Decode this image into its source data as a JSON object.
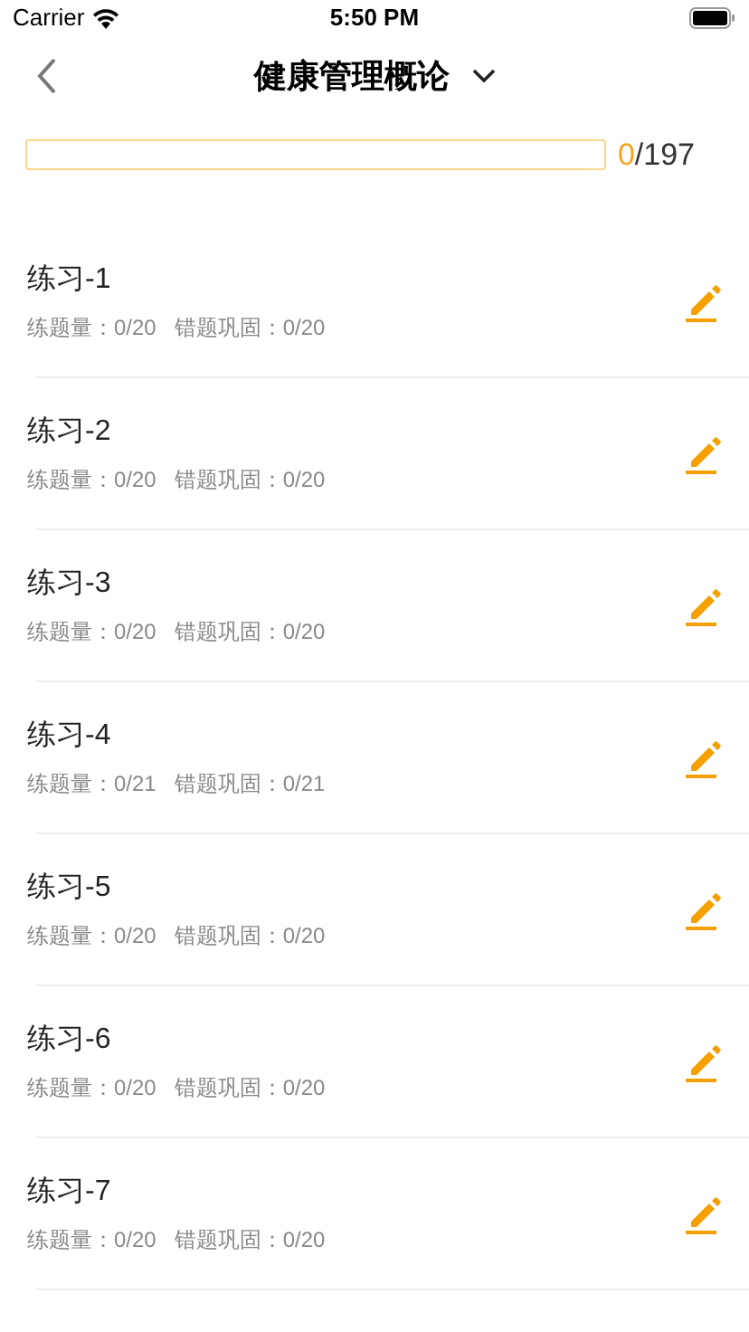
{
  "status_bar": {
    "carrier": "Carrier",
    "time": "5:50 PM"
  },
  "nav": {
    "title": "健康管理概论"
  },
  "progress": {
    "level": 0,
    "done": "0",
    "total": "/197"
  },
  "exercises": [
    {
      "title": "练习-1",
      "practice": "练题量：0/20",
      "review": "错题巩固：0/20"
    },
    {
      "title": "练习-2",
      "practice": "练题量：0/20",
      "review": "错题巩固：0/20"
    },
    {
      "title": "练习-3",
      "practice": "练题量：0/20",
      "review": "错题巩固：0/20"
    },
    {
      "title": "练习-4",
      "practice": "练题量：0/21",
      "review": "错题巩固：0/21"
    },
    {
      "title": "练习-5",
      "practice": "练题量：0/20",
      "review": "错题巩固：0/20"
    },
    {
      "title": "练习-6",
      "practice": "练题量：0/20",
      "review": "错题巩固：0/20"
    },
    {
      "title": "练习-7",
      "practice": "练题量：0/20",
      "review": "错题巩固：0/20"
    }
  ]
}
